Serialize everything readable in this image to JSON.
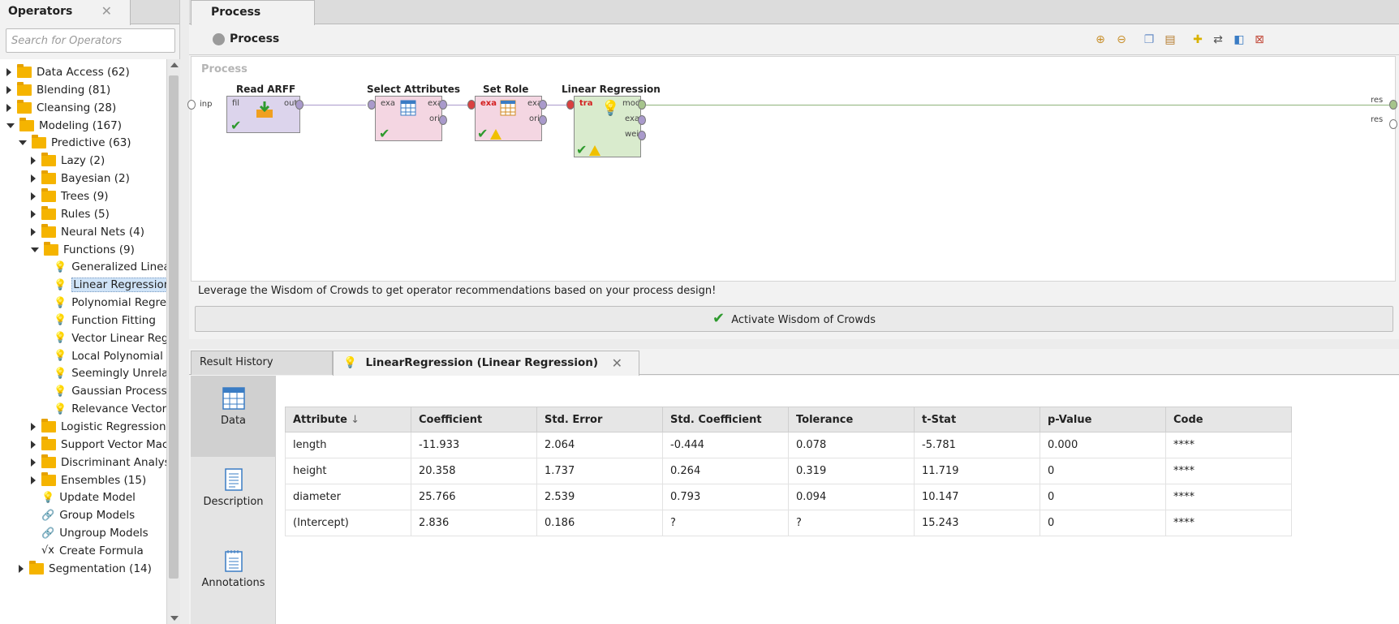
{
  "operators": {
    "tab_title": "Operators",
    "close_glyph": "✕",
    "search_placeholder": "Search for Operators",
    "tree": [
      {
        "label": "Data Access (62)",
        "type": "folder",
        "level": 0,
        "expanded": false
      },
      {
        "label": "Blending (81)",
        "type": "folder",
        "level": 0,
        "expanded": false
      },
      {
        "label": "Cleansing (28)",
        "type": "folder",
        "level": 0,
        "expanded": false
      },
      {
        "label": "Modeling (167)",
        "type": "folder",
        "level": 0,
        "expanded": true
      },
      {
        "label": "Predictive (63)",
        "type": "folder",
        "level": 1,
        "expanded": true
      },
      {
        "label": "Lazy (2)",
        "type": "folder",
        "level": 2,
        "expanded": false
      },
      {
        "label": "Bayesian (2)",
        "type": "folder",
        "level": 2,
        "expanded": false
      },
      {
        "label": "Trees (9)",
        "type": "folder",
        "level": 2,
        "expanded": false
      },
      {
        "label": "Rules (5)",
        "type": "folder",
        "level": 2,
        "expanded": false
      },
      {
        "label": "Neural Nets (4)",
        "type": "folder",
        "level": 2,
        "expanded": false
      },
      {
        "label": "Functions (9)",
        "type": "folder",
        "level": 2,
        "expanded": true
      },
      {
        "label": "Generalized Linear",
        "type": "operator",
        "level": 3
      },
      {
        "label": "Linear Regression",
        "type": "operator",
        "level": 3,
        "selected": true
      },
      {
        "label": "Polynomial Regres",
        "type": "operator",
        "level": 3
      },
      {
        "label": "Function Fitting",
        "type": "operator",
        "level": 3
      },
      {
        "label": "Vector Linear Regr",
        "type": "operator",
        "level": 3
      },
      {
        "label": "Local Polynomial R",
        "type": "operator",
        "level": 3
      },
      {
        "label": "Seemingly Unrelate",
        "type": "operator",
        "level": 3
      },
      {
        "label": "Gaussian Process",
        "type": "operator",
        "level": 3
      },
      {
        "label": "Relevance Vector I",
        "type": "operator",
        "level": 3
      },
      {
        "label": "Logistic Regression (",
        "type": "folder",
        "level": 2,
        "expanded": false
      },
      {
        "label": "Support Vector Mach",
        "type": "folder",
        "level": 2,
        "expanded": false
      },
      {
        "label": "Discriminant Analysis",
        "type": "folder",
        "level": 2,
        "expanded": false
      },
      {
        "label": "Ensembles (15)",
        "type": "folder",
        "level": 2,
        "expanded": false
      },
      {
        "label": "Update Model",
        "type": "operator-y",
        "level": 2
      },
      {
        "label": "Group Models",
        "type": "link",
        "level": 2
      },
      {
        "label": "Ungroup Models",
        "type": "link",
        "level": 2
      },
      {
        "label": "Create Formula",
        "type": "formula",
        "level": 2
      },
      {
        "label": "Segmentation (14)",
        "type": "folder",
        "level": 1,
        "expanded": false
      }
    ]
  },
  "process": {
    "tab_title": "Process",
    "header_title": "Process",
    "canvas_label": "Process",
    "operators": {
      "read_arff": {
        "name": "Read ARFF",
        "in_port": "fil",
        "out_port": "out"
      },
      "select_attributes": {
        "name": "Select Attributes",
        "in_port": "exa",
        "out1": "exa",
        "out2": "ori"
      },
      "set_role": {
        "name": "Set Role",
        "in_port": "exa",
        "out1": "exa",
        "out2": "ori"
      },
      "linear_regression": {
        "name": "Linear Regression",
        "in_port": "tra",
        "out1": "mod",
        "out2": "exa",
        "out3": "wei"
      }
    },
    "inp_label": "inp",
    "res_label_1": "res",
    "res_label_2": "res",
    "wisdom_message": "Leverage the Wisdom of Crowds to get operator recommendations based on your process design!",
    "wisdom_button": "Activate Wisdom of Crowds"
  },
  "results": {
    "tab_history": "Result History",
    "tab_active": "LinearRegression (Linear Regression)",
    "close_glyph": "✕",
    "side": {
      "data": "Data",
      "description": "Description",
      "annotations": "Annotations"
    },
    "columns": [
      "Attribute",
      "Coefficient",
      "Std. Error",
      "Std. Coefficient",
      "Tolerance",
      "t-Stat",
      "p-Value",
      "Code"
    ],
    "sort_glyph": "↓",
    "rows": [
      [
        "length",
        "-11.933",
        "2.064",
        "-0.444",
        "0.078",
        "-5.781",
        "0.000",
        "****"
      ],
      [
        "height",
        "20.358",
        "1.737",
        "0.264",
        "0.319",
        "11.719",
        "0",
        "****"
      ],
      [
        "diameter",
        "25.766",
        "2.539",
        "0.793",
        "0.094",
        "10.147",
        "0",
        "****"
      ],
      [
        "(Intercept)",
        "2.836",
        "0.186",
        "?",
        "?",
        "15.243",
        "0",
        "****"
      ]
    ]
  },
  "colors": {
    "operator_purple": "#dcd4ec",
    "operator_pink": "#f4d6e2",
    "operator_green": "#d9ebcd",
    "selection_blue": "#cfe3f7"
  }
}
